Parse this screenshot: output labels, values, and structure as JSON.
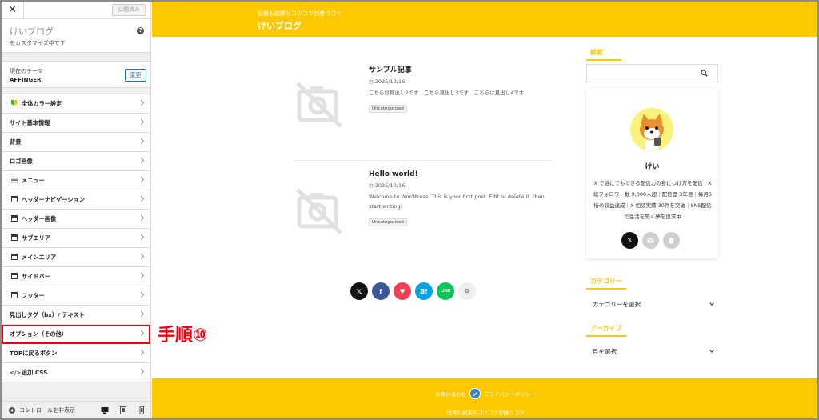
{
  "customizer": {
    "close_glyph": "✕",
    "publish_label": "公開済み",
    "site_name": "けいブログ",
    "customizing_label": "をカスタマイズ中です",
    "help_glyph": "?",
    "theme_label": "現在のテーマ",
    "theme_name": "AFFINGER",
    "change_label": "変更",
    "menu": [
      {
        "icon": "color-icon",
        "label": "全体カラー設定"
      },
      {
        "icon": "",
        "label": "サイト基本情報"
      },
      {
        "icon": "",
        "label": "背景"
      },
      {
        "icon": "",
        "label": "ロゴ画像"
      },
      {
        "icon": "menu-icon",
        "label": "メニュー"
      },
      {
        "icon": "layout-icon",
        "label": "ヘッダーナビゲーション"
      },
      {
        "icon": "layout-icon",
        "label": "ヘッダー画像"
      },
      {
        "icon": "layout-icon",
        "label": "サブエリア"
      },
      {
        "icon": "layout-icon",
        "label": "メインエリア"
      },
      {
        "icon": "layout-icon",
        "label": "サイドバー"
      },
      {
        "icon": "layout-icon",
        "label": "フッター"
      },
      {
        "icon": "",
        "label": "見出しタグ（hx）/ テキスト"
      },
      {
        "icon": "",
        "label": "オプション（その他）"
      },
      {
        "icon": "",
        "label": "TOPに戻るボタン"
      },
      {
        "icon": "code-icon",
        "label": "追加 CSS"
      }
    ],
    "hide_controls_label": "コントロールを非表示"
  },
  "annotation": "手順⑩",
  "preview": {
    "tagline": "投資も副業もコツコツが勝つコツ",
    "site_title": "けいブログ",
    "posts": [
      {
        "title": "サンプル記事",
        "date": "2025/10/16",
        "excerpt": "こちらは見出し2です　こちら見出し3です　こちらは見出し4です",
        "category": "Uncategorized"
      },
      {
        "title": "Hello world!",
        "date": "2025/10/16",
        "excerpt": "Welcome to WordPress. This is your first post. Edit or delete it, then start writing!",
        "category": "Uncategorized"
      }
    ],
    "share_buttons": [
      {
        "name": "x-share",
        "label": "𝕏",
        "color": "#111111"
      },
      {
        "name": "facebook-share",
        "label": "f",
        "color": "#3b5998"
      },
      {
        "name": "pocket-share",
        "label": "♥",
        "color": "#ef4056"
      },
      {
        "name": "hatena-share",
        "label": "B!",
        "color": "#00a4de"
      },
      {
        "name": "line-share",
        "label": "LINE",
        "color": "#06c755"
      },
      {
        "name": "copy-share",
        "label": "⧉",
        "color": "#eeeeee"
      }
    ],
    "search_title": "検索",
    "profile": {
      "name": "けい",
      "description": "X で誰にでもできる配信力の身につけ方を配信｜X 総フォロワー数 9,000人超｜配信歴 3年目｜毎月5桁の収益達成｜X 相談実績 30件を突破｜SNS配信で生活を築く夢を追求中"
    },
    "category_title": "カテゴリー",
    "category_select": "カテゴリーを選択",
    "archive_title": "アーカイブ",
    "archive_select": "月を選択",
    "footer_contact": "お問い合わせ",
    "footer_privacy": "プライバシーポリシー",
    "footer_copy": "投資も副業もコツコツが勝つコツ"
  },
  "colors": {
    "accent": "#fcc800",
    "highlight": "#e60012",
    "wp_blue": "#2271b1"
  }
}
